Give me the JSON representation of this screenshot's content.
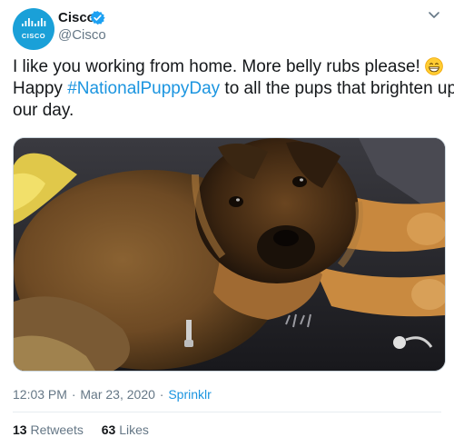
{
  "author": {
    "display_name": "Cisco",
    "handle": "@Cisco",
    "avatar_text": "CISCO",
    "verified": true,
    "brand_color": "#1aa0d8"
  },
  "tweet": {
    "line1": "I like you working from home. More belly rubs please!",
    "emoji": "grinning-face-emoji",
    "line2_prefix": "Happy ",
    "hashtag": "#NationalPuppyDay",
    "line2_suffix": " to all the pups that brighten up",
    "line3": "our day.",
    "time": "12:03 PM",
    "date": "Mar 23, 2020",
    "source": "Sprinklr"
  },
  "stats": {
    "retweets_count": "13",
    "retweets_label": "Retweets",
    "likes_count": "63",
    "likes_label": "Likes"
  },
  "colors": {
    "link": "#1b95e0",
    "muted": "#657786",
    "text": "#14171a"
  }
}
